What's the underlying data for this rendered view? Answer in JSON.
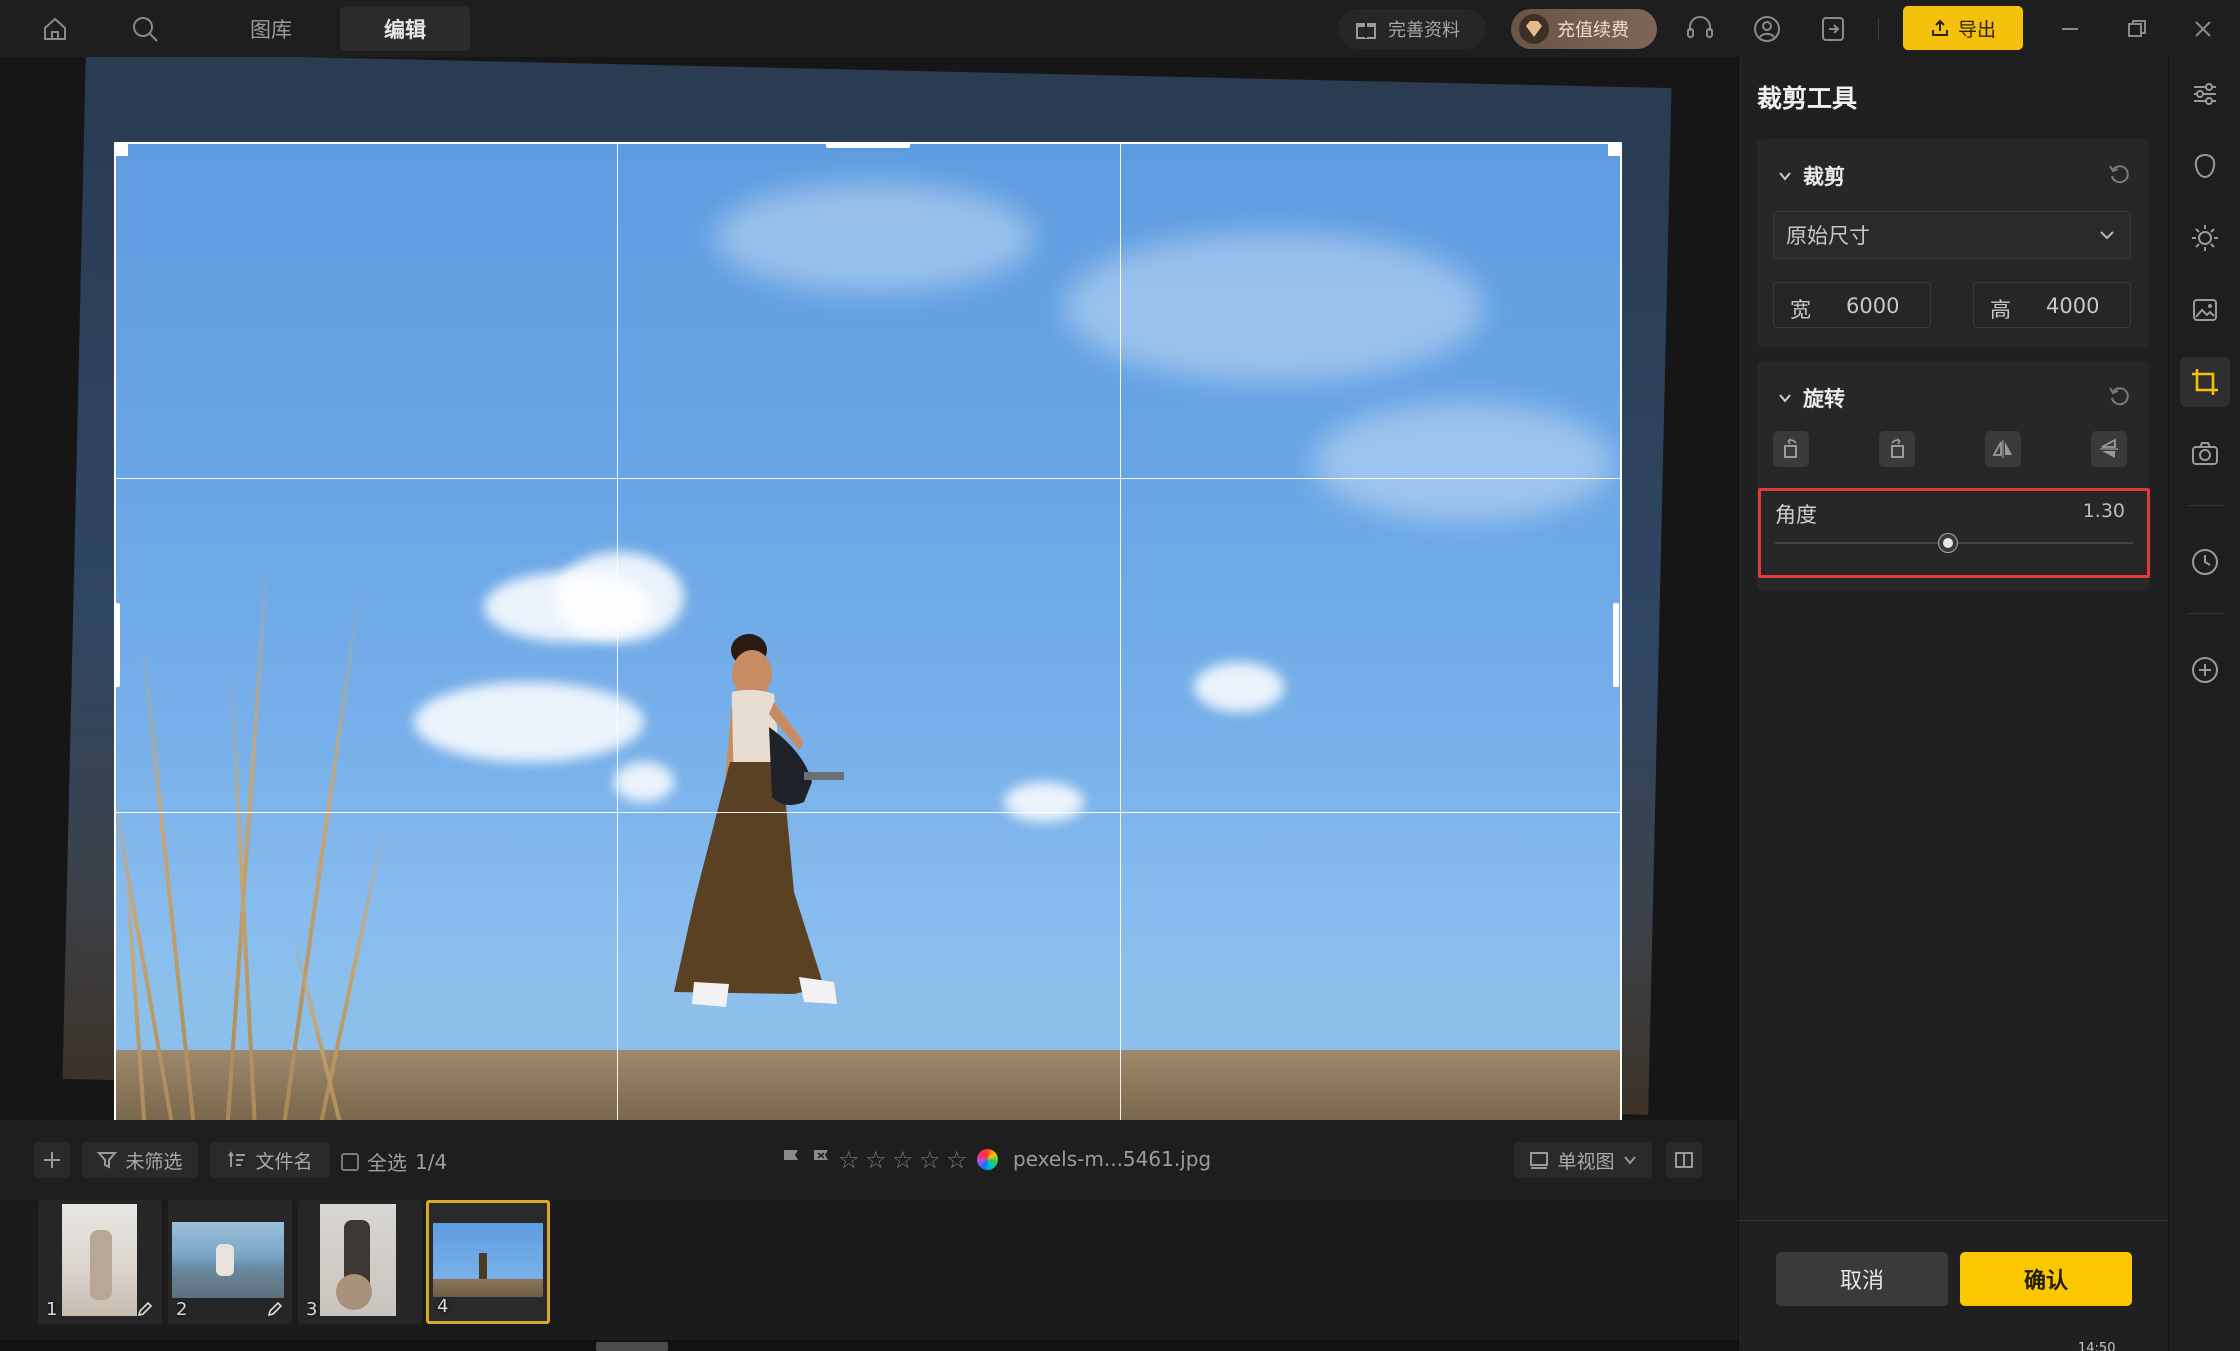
{
  "topbar": {
    "tabs": [
      {
        "label": "图库",
        "active": false
      },
      {
        "label": "编辑",
        "active": true
      }
    ],
    "gift_label": "完善资料",
    "vip_label": "充值续费",
    "export_label": "导出",
    "accent": "#f4c20d"
  },
  "panel": {
    "title": "裁剪工具",
    "crop": {
      "header": "裁剪",
      "ratio_selected": "原始尺寸",
      "width_label": "宽",
      "width_value": "6000",
      "height_label": "高",
      "height_value": "4000"
    },
    "rotate": {
      "header": "旋转",
      "buttons": [
        "rotate-left-icon",
        "rotate-right-icon",
        "flip-horizontal-icon",
        "flip-vertical-icon"
      ],
      "angle_label": "角度",
      "angle_value": "1.30",
      "highlight_color": "#e03b3b"
    },
    "cancel_label": "取消",
    "confirm_label": "确认",
    "confirm_color": "#fbc800"
  },
  "toolbar": {
    "filter_label": "未筛选",
    "sort_label": "文件名",
    "select_all_label": "全选",
    "select_count": "1/4",
    "filename": "pexels-m...5461.jpg",
    "rating_stars": 0,
    "view_label": "单视图"
  },
  "filmstrip": {
    "thumbs": [
      {
        "num": "1",
        "edited": true,
        "selected": false
      },
      {
        "num": "2",
        "edited": true,
        "selected": false
      },
      {
        "num": "3",
        "edited": false,
        "selected": false
      },
      {
        "num": "4",
        "edited": false,
        "selected": true
      }
    ]
  },
  "rail": {
    "icons": [
      "adjust-sliders-icon",
      "portrait-icon",
      "brightness-icon",
      "image-edit-icon",
      "crop-icon",
      "camera-icon",
      "history-icon",
      "add-icon"
    ],
    "active": "crop-icon"
  },
  "canvas": {
    "rotation_deg": 1.3,
    "grid": "rule-of-thirds"
  },
  "clock": "14:50"
}
